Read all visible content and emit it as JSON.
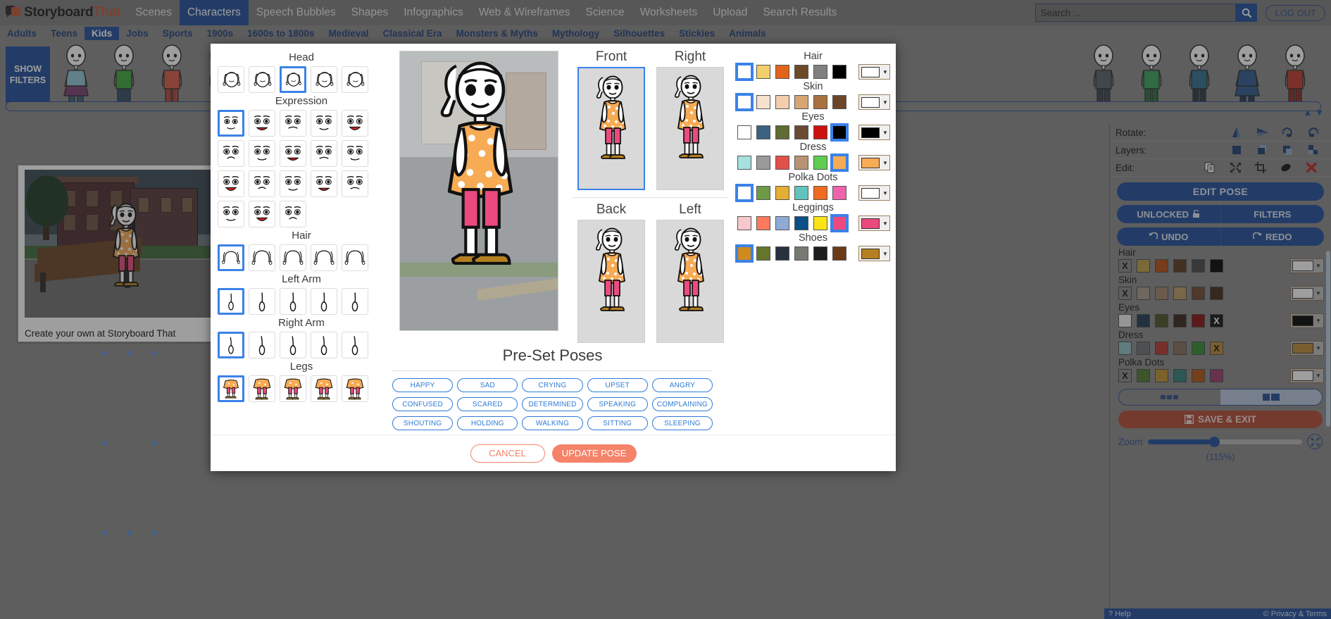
{
  "app": {
    "brand_main": "Storyboard",
    "brand_accent": "That",
    "logout_label": "LOG OUT"
  },
  "nav": {
    "items": [
      {
        "label": "Scenes",
        "active": false
      },
      {
        "label": "Characters",
        "active": true
      },
      {
        "label": "Speech Bubbles",
        "active": false
      },
      {
        "label": "Shapes",
        "active": false
      },
      {
        "label": "Infographics",
        "active": false
      },
      {
        "label": "Web & Wireframes",
        "active": false
      },
      {
        "label": "Science",
        "active": false
      },
      {
        "label": "Worksheets",
        "active": false
      },
      {
        "label": "Upload",
        "active": false
      },
      {
        "label": "Search Results",
        "active": false
      }
    ]
  },
  "subnav": {
    "items": [
      {
        "label": "Adults",
        "active": false
      },
      {
        "label": "Teens",
        "active": false
      },
      {
        "label": "Kids",
        "active": true
      },
      {
        "label": "Jobs",
        "active": false
      },
      {
        "label": "Sports",
        "active": false
      },
      {
        "label": "1900s",
        "active": false
      },
      {
        "label": "1600s to 1800s",
        "active": false
      },
      {
        "label": "Medieval",
        "active": false
      },
      {
        "label": "Classical Era",
        "active": false
      },
      {
        "label": "Monsters & Myths",
        "active": false
      },
      {
        "label": "Mythology",
        "active": false
      },
      {
        "label": "Silhouettes",
        "active": false
      },
      {
        "label": "Stickies",
        "active": false
      },
      {
        "label": "Animals",
        "active": false
      }
    ]
  },
  "search": {
    "value": "",
    "placeholder": "Search ...",
    "icon": "search-icon"
  },
  "filters": {
    "show_filters_line1": "SHOW",
    "show_filters_line2": "FILTERS"
  },
  "canvas": {
    "caption": "Create your own at Storyboard That"
  },
  "sidebar": {
    "rotate_label": "Rotate:",
    "layers_label": "Layers:",
    "edit_label": "Edit:",
    "rotate_icons": [
      "flip-horizontal-icon",
      "flip-vertical-icon",
      "rotate-left-icon",
      "rotate-right-icon"
    ],
    "layer_icons": [
      "bring-to-front-icon",
      "bring-forward-icon",
      "send-backward-icon",
      "send-to-back-icon"
    ],
    "edit_icons": [
      "duplicate-icon",
      "resize-icon",
      "crop-icon",
      "eraser-icon",
      "delete-icon"
    ],
    "edit_pose_label": "EDIT POSE",
    "unlocked_label": "UNLOCKED",
    "filters_label": "FILTERS",
    "undo_label": "UNDO",
    "redo_label": "REDO",
    "save_exit_label": "SAVE & EXIT",
    "zoom_label": "Zoom",
    "zoom_percent": "(115%)",
    "color_groups": [
      {
        "name": "Hair",
        "swatches": [
          "none",
          "#bda042",
          "#b74e11",
          "#5b3a1c",
          "#474747",
          "#000000"
        ],
        "selected_index": 0,
        "current": "#ffffff"
      },
      {
        "name": "Skin",
        "swatches": [
          "none",
          "#a79c89",
          "#a58467",
          "#c19a67",
          "#6e4a2c",
          "#43291a"
        ],
        "selected_index": 0,
        "current": "#ffffff"
      },
      {
        "name": "Eyes",
        "swatches": [
          "#eeeeee",
          "#1f3950",
          "#4b5229",
          "#3a2519",
          "#8b0d11",
          "#111111"
        ],
        "selected_index": 5,
        "current": "#000000"
      },
      {
        "name": "Dress",
        "swatches": [
          "#8fc2c7",
          "#6e7379",
          "#b8362e",
          "#85705b",
          "#338a33",
          "#c08a38"
        ],
        "selected_index": 5,
        "current": "#c08a38"
      },
      {
        "name": "Polka Dots",
        "swatches": [
          "none",
          "#4f7a2c",
          "#c0922f",
          "#2e7e7c",
          "#b25512",
          "#9b3a72"
        ],
        "selected_index": 0,
        "current": "#ffffff"
      }
    ]
  },
  "footer": {
    "help_label": "Help",
    "privacy_label": "© Privacy & Terms"
  },
  "modal": {
    "parts": [
      {
        "name": "Head",
        "count": 5,
        "selected_index": 2,
        "icon": "head-thumb"
      },
      {
        "name": "Expression",
        "count": 18,
        "selected_index": 0,
        "icon": "expression-thumb"
      },
      {
        "name": "Hair",
        "count": 5,
        "selected_index": 0,
        "icon": "hair-thumb"
      },
      {
        "name": "Left Arm",
        "count": 5,
        "selected_index": 0,
        "icon": "left-arm-thumb"
      },
      {
        "name": "Right Arm",
        "count": 5,
        "selected_index": 0,
        "icon": "right-arm-thumb"
      },
      {
        "name": "Legs",
        "count": 5,
        "selected_index": 0,
        "icon": "legs-thumb"
      }
    ],
    "views": [
      {
        "label": "Front",
        "selected": true
      },
      {
        "label": "Right",
        "selected": false
      },
      {
        "label": "Back",
        "selected": false
      },
      {
        "label": "Left",
        "selected": false
      }
    ],
    "color_groups": [
      {
        "name": "Hair",
        "swatches": [
          "none",
          "#f2cf6a",
          "#e1641a",
          "#6d4a28",
          "#808080",
          "#000000"
        ],
        "selected_index": 0,
        "current": "#ffffff"
      },
      {
        "name": "Skin",
        "swatches": [
          "none",
          "#f6e2cd",
          "#f2cdae",
          "#d6a573",
          "#a9713e",
          "#6d4527"
        ],
        "selected_index": 0,
        "current": "#ffffff"
      },
      {
        "name": "Eyes",
        "swatches": [
          "#ffffff",
          "#3b6280",
          "#5e6b32",
          "#6a4a35",
          "#cc1111",
          "#000000"
        ],
        "selected_index": 5,
        "current": "#000000"
      },
      {
        "name": "Dress",
        "swatches": [
          "#a6e0df",
          "#9a9a9a",
          "#e2504a",
          "#b99472",
          "#5fcd52",
          "#f7ab54"
        ],
        "selected_index": 5,
        "current": "#f7ab54"
      },
      {
        "name": "Polka Dots",
        "swatches": [
          "none",
          "#6d9a46",
          "#e2ae33",
          "#62c3bd",
          "#ef6b20",
          "#ef63ad"
        ],
        "selected_index": 0,
        "current": "#ffffff"
      },
      {
        "name": "Leggings",
        "swatches": [
          "#f7c8cc",
          "#ff7a5c",
          "#8fabd4",
          "#0a4f86",
          "#fbe415",
          "#ec4a7f"
        ],
        "selected_index": 5,
        "current": "#ec4a7f"
      },
      {
        "name": "Shoes",
        "swatches": [
          "#cf8a1c",
          "#63762c",
          "#28323f",
          "#777a72",
          "#1d1d1d",
          "#6d3a16"
        ],
        "selected_index": 0,
        "current": "#b4801f"
      }
    ],
    "presets_title": "Pre-Set Poses",
    "preset_rows": [
      [
        "HAPPY",
        "SAD",
        "CRYING",
        "UPSET",
        "ANGRY"
      ],
      [
        "CONFUSED",
        "SCARED",
        "DETERMINED",
        "SPEAKING",
        "COMPLAINING"
      ],
      [
        "SHOUTING",
        "HOLDING",
        "WALKING",
        "SITTING",
        "SLEEPING"
      ]
    ],
    "cancel_label": "CANCEL",
    "update_label": "UPDATE POSE"
  },
  "theme": {
    "blue": "#1f4e9c",
    "link_blue": "#2f7ad6",
    "orange": "#f4836a",
    "accent_red": "#b24a34",
    "select_blue": "#3b82e8"
  }
}
